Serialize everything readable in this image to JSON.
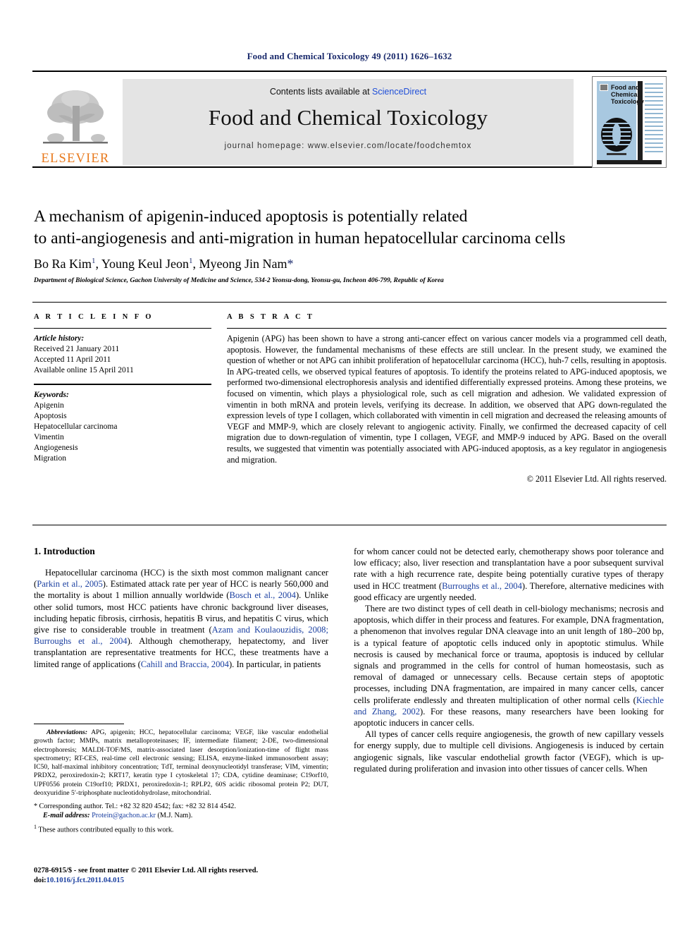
{
  "running_head": "Food and Chemical Toxicology 49 (2011) 1626–1632",
  "banner": {
    "contents_prefix": "Contents lists available at ",
    "sciencedirect": "ScienceDirect",
    "journal_title": "Food and Chemical Toxicology",
    "homepage": "journal homepage: www.elsevier.com/locate/foodchemtox",
    "publisher_wordmark": "ELSEVIER",
    "cover_title_line1": "Food and",
    "cover_title_line2": "Chemical",
    "cover_title_line3": "Toxicology"
  },
  "article": {
    "title_line1": "A mechanism of apigenin-induced apoptosis is potentially related",
    "title_line2": "to anti-angiogenesis and anti-migration in human hepatocellular carcinoma cells",
    "authors": "Bo Ra Kim, Young Keul Jeon, Myeong Jin Nam",
    "author_list": [
      {
        "name": "Bo Ra Kim",
        "mark": "1"
      },
      {
        "name": "Young Keul Jeon",
        "mark": "1"
      },
      {
        "name": "Myeong Jin Nam",
        "mark": "*"
      }
    ],
    "affiliation": "Department of Biological Science, Gachon University of Medicine and Science, 534-2 Yeonsu-dong, Yeonsu-gu, Incheon 406-799, Republic of Korea"
  },
  "article_info": {
    "heading": "A R T I C L E   I N F O",
    "history_label": "Article history:",
    "history": [
      "Received 21 January 2011",
      "Accepted 11 April 2011",
      "Available online 15 April 2011"
    ],
    "keywords_label": "Keywords:",
    "keywords": [
      "Apigenin",
      "Apoptosis",
      "Hepatocellular carcinoma",
      "Vimentin",
      "Angiogenesis",
      "Migration"
    ]
  },
  "abstract": {
    "heading": "A B S T R A C T",
    "text": "Apigenin (APG) has been shown to have a strong anti-cancer effect on various cancer models via a programmed cell death, apoptosis. However, the fundamental mechanisms of these effects are still unclear. In the present study, we examined the question of whether or not APG can inhibit proliferation of hepatocellular carcinoma (HCC), huh-7 cells, resulting in apoptosis. In APG-treated cells, we observed typical features of apoptosis. To identify the proteins related to APG-induced apoptosis, we performed two-dimensional electrophoresis analysis and identified differentially expressed proteins. Among these proteins, we focused on vimentin, which plays a physiological role, such as cell migration and adhesion. We validated expression of vimentin in both mRNA and protein levels, verifying its decrease. In addition, we observed that APG down-regulated the expression levels of type I collagen, which collaborated with vimentin in cell migration and decreased the releasing amounts of VEGF and MMP-9, which are closely relevant to angiogenic activity. Finally, we confirmed the decreased capacity of cell migration due to down-regulation of vimentin, type I collagen, VEGF, and MMP-9 induced by APG. Based on the overall results, we suggested that vimentin was potentially associated with APG-induced apoptosis, as a key regulator in angiogenesis and migration.",
    "copyright": "© 2011 Elsevier Ltd. All rights reserved."
  },
  "introduction": {
    "heading": "1. Introduction",
    "left_paragraph_1_part1": "Hepatocellular carcinoma (HCC) is the sixth most common malignant cancer (",
    "left_cite_1": "Parkin et al., 2005",
    "left_paragraph_1_part2": "). Estimated attack rate per year of HCC is nearly 560,000 and the mortality is about 1 million annually worldwide (",
    "left_cite_2": "Bosch et al., 2004",
    "left_paragraph_1_part3": "). Unlike other solid tumors, most HCC patients have chronic background liver diseases, including hepatic fibrosis, cirrhosis, hepatitis B virus, and hepatitis C virus, which give rise to considerable trouble in treatment (",
    "left_cite_3": "Azam and Koulaouzidis, 2008; Burroughs et al., 2004",
    "left_paragraph_1_part4": "). Although chemotherapy, hepatectomy, and liver transplantation are representative treatments for HCC, these treatments have a limited range of applications (",
    "left_cite_4": "Cahill and Braccia, 2004",
    "left_paragraph_1_part5": "). In particular, in patients",
    "right_paragraph_1_part1": "for whom cancer could not be detected early, chemotherapy shows poor tolerance and low efficacy; also, liver resection and transplantation have a poor subsequent survival rate with a high recurrence rate, despite being potentially curative types of therapy used in HCC treatment (",
    "right_cite_1": "Burroughs et al., 2004",
    "right_paragraph_1_part2": "). Therefore, alternative medicines with good efficacy are urgently needed.",
    "right_paragraph_2_part1": "There are two distinct types of cell death in cell-biology mechanisms; necrosis and apoptosis, which differ in their process and features. For example, DNA fragmentation, a phenomenon that involves regular DNA cleavage into an unit length of 180–200 bp, is a typical feature of apoptotic cells induced only in apoptotic stimulus. While necrosis is caused by mechanical force or trauma, apoptosis is induced by cellular signals and programmed in the cells for control of human homeostasis, such as removal of damaged or unnecessary cells. Because certain steps of apoptotic processes, including DNA fragmentation, are impaired in many cancer cells, cancer cells proliferate endlessly and threaten multiplication of other normal cells (",
    "right_cite_2": "Kiechle and Zhang, 2002",
    "right_paragraph_2_part2": "). For these reasons, many researchers have been looking for apoptotic inducers in cancer cells.",
    "right_paragraph_3": "All types of cancer cells require angiogenesis, the growth of new capillary vessels for energy supply, due to multiple cell divisions. Angiogenesis is induced by certain angiogenic signals, like vascular endothelial growth factor (VEGF), which is up-regulated during proliferation and invasion into other tissues of cancer cells. When"
  },
  "footnotes": {
    "abbreviations_label": "Abbreviations:",
    "abbreviations_text": " APG, apigenin; HCC, hepatocellular carcinoma; VEGF, like vascular endothelial growth factor; MMPs, matrix metalloproteinases; IF, intermediate filament; 2-DE, two-dimensional electrophoresis; MALDI-TOF/MS, matrix-associated laser desorption/ionization-time of flight mass spectrometry; RT-CES, real-time cell electronic sensing; ELISA, enzyme-linked immunosorbent assay; IC50, half-maximal inhibitory concentration; TdT, terminal deoxynucleotidyl transferase; VIM, vimentin; PRDX2, peroxiredoxin-2; KRT17, keratin type I cytoskeletal 17; CDA, cytidine deaminase; C19orf10, UPF0556 protein C19orf10; PRDX1, peroxiredoxin-1; RPLP2, 60S acidic ribosomal protein P2; DUT, deoxyuridine 5′-triphosphate nucleotidohydrolase, mitochondrial.",
    "corresponding_marker": "*",
    "corresponding_text": "Corresponding author. Tel.: +82 32 820 4542; fax: +82 32 814 4542.",
    "email_label": "E-mail address:",
    "email_value": "Protein@gachon.ac.kr",
    "email_suffix": " (M.J. Nam).",
    "equal_marker": "1",
    "equal_text": "These authors contributed equally to this work."
  },
  "imprint": {
    "issn_line": "0278-6915/$ - see front matter © 2011 Elsevier Ltd. All rights reserved.",
    "doi_label": "doi:",
    "doi_value": "10.1016/j.fct.2011.04.015"
  },
  "colors": {
    "link": "#1a3fa0",
    "running_head": "#1a2a6c",
    "elsevier_orange": "#e87a1e",
    "banner_bg": "#e4e4e4",
    "cover_blue": "#a8c8e0"
  }
}
